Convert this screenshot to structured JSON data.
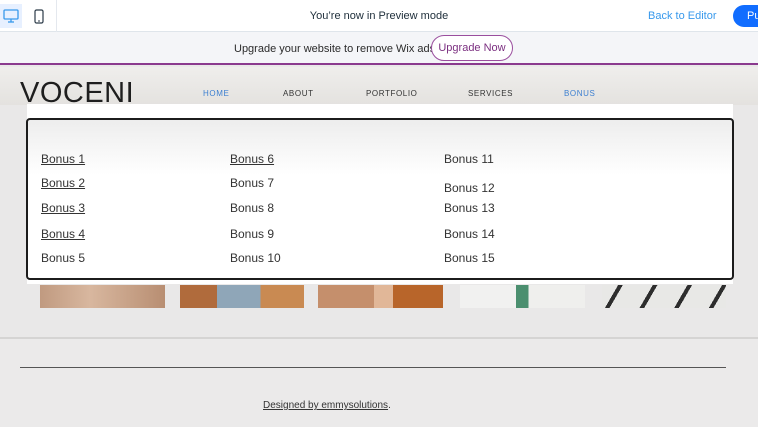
{
  "topbar": {
    "preview_text": "You’re now in Preview mode",
    "back_label": "Back to Editor",
    "publish_label": "Pu",
    "desktop_icon": "desktop-icon",
    "mobile_icon": "mobile-icon"
  },
  "ads": {
    "text": "Upgrade your website to remove Wix ads",
    "button_label": "Upgrade Now"
  },
  "site": {
    "logo": "VOCENI",
    "nav": [
      "HOME",
      "ABOUT",
      "PORTFOLIO",
      "SERVICES",
      "BONUS"
    ],
    "active_nav": [
      "HOME",
      "BONUS"
    ]
  },
  "dropdown": {
    "col1": [
      "Bonus 1",
      "Bonus 2",
      "Bonus 3",
      "Bonus 4",
      "Bonus 5"
    ],
    "col2": [
      "Bonus 6",
      "Bonus 7",
      "Bonus 8",
      "Bonus 9",
      "Bonus 10"
    ],
    "col3": [
      "Bonus 11",
      "Bonus 12",
      "Bonus 13",
      "Bonus 14",
      "Bonus 15"
    ]
  },
  "footer": {
    "credit_link": "Designed by emmysolutions",
    "credit_suffix": "."
  },
  "colors": {
    "accent": "#116dff",
    "link": "#3899ec",
    "ads_purple": "#8a3a8e",
    "nav_active": "#3c7fd1"
  }
}
